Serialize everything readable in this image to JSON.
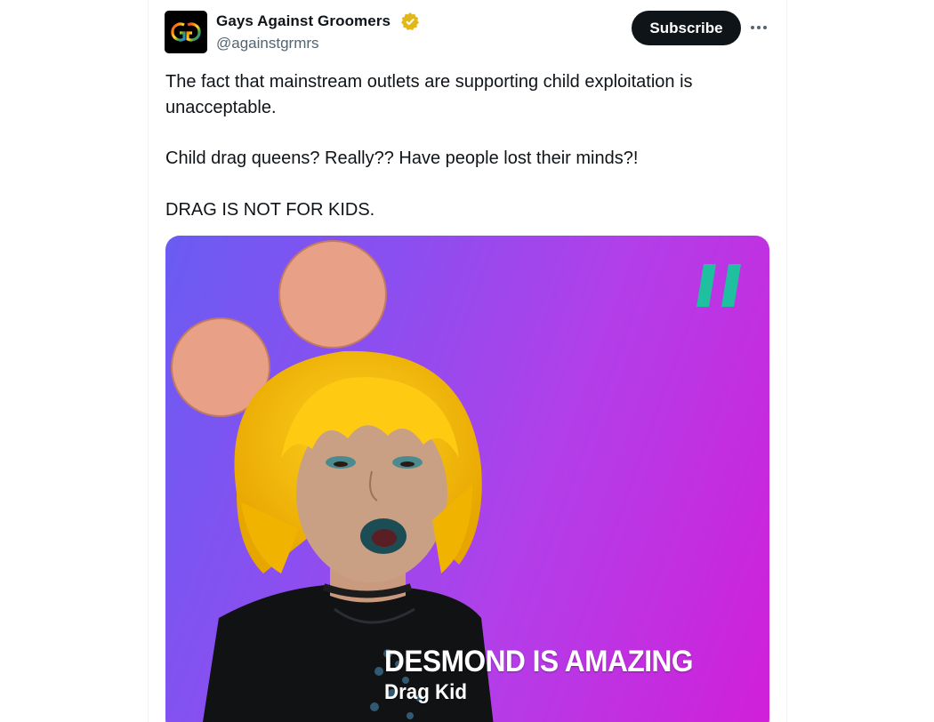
{
  "tweet": {
    "author": {
      "display_name": "Gays Against Groomers",
      "handle": "@againstgrmrs",
      "verified": true,
      "verified_color": "#e2b719",
      "avatar_icon": "gg-logo-icon"
    },
    "subscribe_label": "Subscribe",
    "more_icon": "more-horizontal-icon",
    "text_lines": [
      "The fact that mainstream outlets are supporting child exploitation is unacceptable.",
      "Child drag queens? Really?? Have people lost their minds?!",
      "DRAG IS NOT FOR KIDS."
    ],
    "media": {
      "headline": "DESMOND IS AMAZING",
      "subheadline": "Drag Kid",
      "brand_icon": "huffpost-quote-icon",
      "brand_color": "#1fc0a0"
    }
  },
  "colors": {
    "text_primary": "#0f1419",
    "text_secondary": "#536471",
    "button_bg": "#0f1419"
  }
}
